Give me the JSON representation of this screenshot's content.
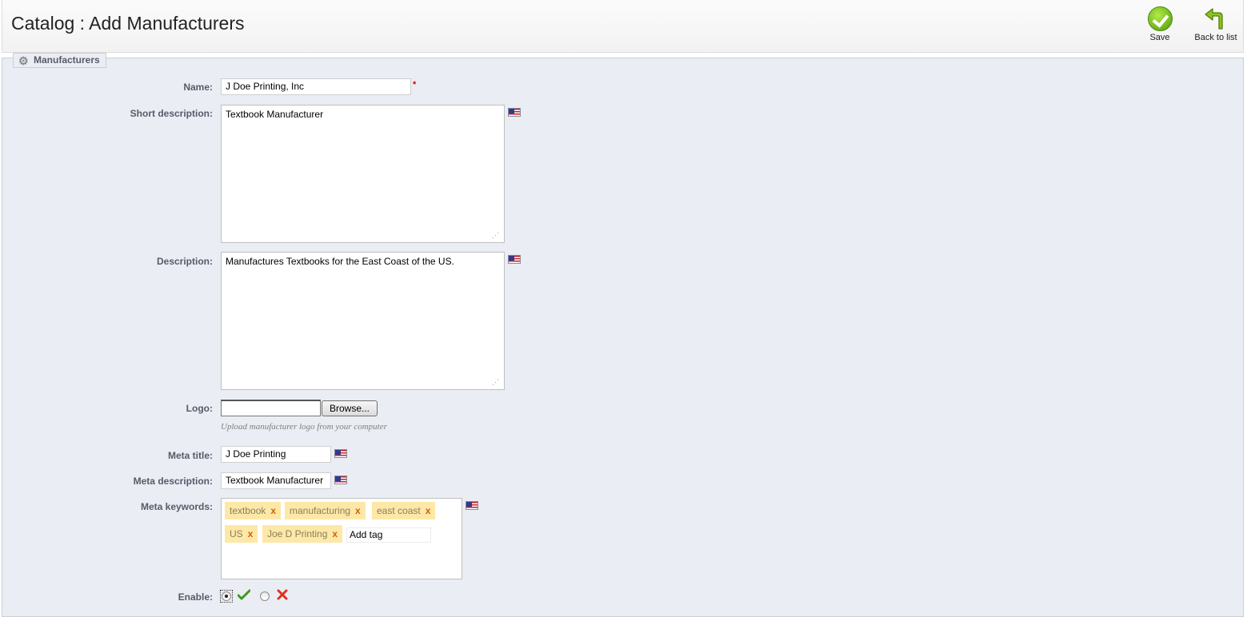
{
  "header": {
    "title": "Catalog : Add Manufacturers",
    "save_label": "Save",
    "back_label": "Back to list"
  },
  "section": {
    "legend": "Manufacturers",
    "icon": "gear-icon"
  },
  "form": {
    "name": {
      "label": "Name:",
      "value": "J Doe Printing, Inc",
      "required_mark": "*"
    },
    "short_description": {
      "label": "Short description:",
      "value": "Textbook Manufacturer"
    },
    "description": {
      "label": "Description:",
      "value": "Manufactures Textbooks for the East Coast of the US."
    },
    "logo": {
      "label": "Logo:",
      "browse_label": "Browse...",
      "hint": "Upload manufacturer logo from your computer"
    },
    "meta_title": {
      "label": "Meta title:",
      "value": "J Doe Printing"
    },
    "meta_description": {
      "label": "Meta description:",
      "value": "Textbook Manufacturer"
    },
    "meta_keywords": {
      "label": "Meta keywords:",
      "tags": [
        "textbook",
        "manufacturing",
        "east coast",
        "US",
        "Joe D Printing"
      ],
      "remove_mark": "x",
      "add_placeholder": "Add tag"
    },
    "enable": {
      "label": "Enable:",
      "selected": "yes"
    }
  },
  "colors": {
    "panel_bg": "#ebedf4",
    "tag_bg": "#fde8a7",
    "label_color": "#585a69",
    "accent_green": "#6db21a",
    "cancel_red": "#e0301e"
  }
}
